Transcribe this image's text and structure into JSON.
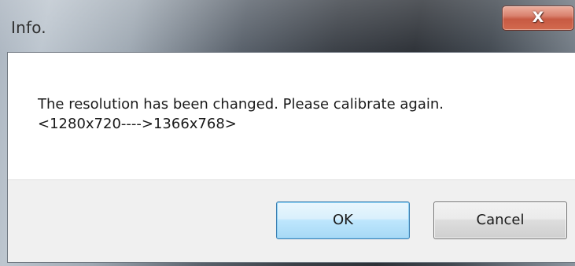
{
  "window": {
    "title": "Info."
  },
  "title_bar": {
    "close_icon": "close-icon",
    "close_glyph": "X"
  },
  "message": {
    "line1": "The resolution has been changed. Please calibrate again.",
    "line2": "<1280x720---->1366x768>"
  },
  "buttons": {
    "ok_label": "OK",
    "cancel_label": "Cancel"
  },
  "colors": {
    "close_button": "#c0442a",
    "ok_button_border": "#3c7fb1",
    "button_area_bg": "#f0f0f0"
  }
}
